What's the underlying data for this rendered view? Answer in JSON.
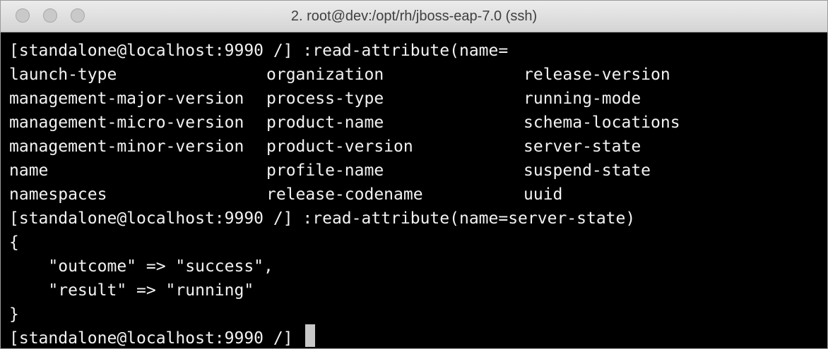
{
  "window": {
    "title": "2. root@dev:/opt/rh/jboss-eap-7.0 (ssh)"
  },
  "terminal": {
    "command_1": "[standalone@localhost:9990 /] :read-attribute(name=",
    "completions": [
      [
        "launch-type",
        "organization",
        "release-version"
      ],
      [
        "management-major-version",
        "process-type",
        "running-mode"
      ],
      [
        "management-micro-version",
        "product-name",
        "schema-locations"
      ],
      [
        "management-minor-version",
        "product-version",
        "server-state"
      ],
      [
        "name",
        "profile-name",
        "suspend-state"
      ],
      [
        "namespaces",
        "release-codename",
        "uuid"
      ]
    ],
    "command_2": "[standalone@localhost:9990 /] :read-attribute(name=server-state)",
    "output": [
      "{",
      "    \"outcome\" => \"success\",",
      "    \"result\" => \"running\"",
      "}"
    ],
    "prompt": "[standalone@localhost:9990 /] "
  },
  "colors": {
    "terminal_background": "#000000",
    "terminal_text": "#f2f2f2",
    "cursor": "#c8c8c8",
    "titlebar": "#dcdcdc"
  }
}
